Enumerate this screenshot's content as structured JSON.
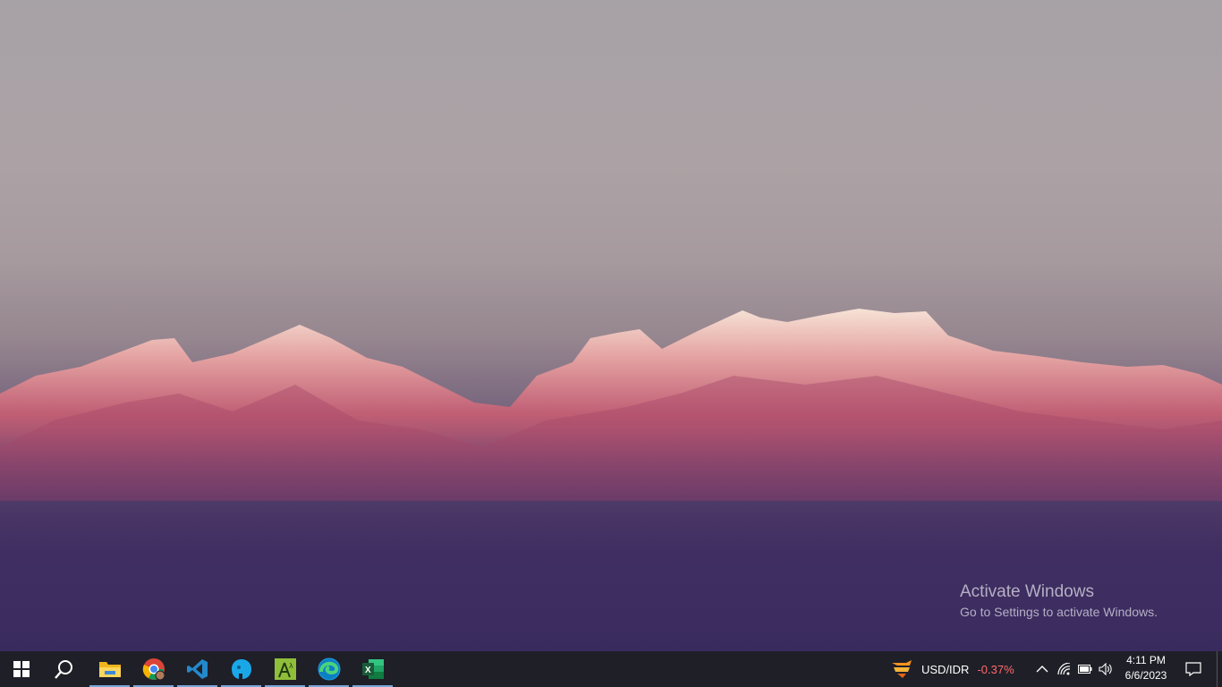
{
  "desktop": {
    "wallpaper": "mountain-range-sunset",
    "watermark": {
      "title": "Activate Windows",
      "subtitle": "Go to Settings to activate Windows."
    }
  },
  "taskbar": {
    "start_icon": "windows-start-icon",
    "search_icon": "search-icon",
    "pinned_apps": [
      {
        "name": "File Explorer",
        "icon": "file-explorer-icon",
        "active": true
      },
      {
        "name": "Google Chrome",
        "icon": "chrome-icon",
        "active": true
      },
      {
        "name": "Visual Studio Code",
        "icon": "vscode-icon",
        "active": true
      },
      {
        "name": "App",
        "icon": "blue-app-icon",
        "active": true
      },
      {
        "name": "App",
        "icon": "green-app-icon",
        "active": true
      },
      {
        "name": "Microsoft Edge",
        "icon": "edge-icon",
        "active": true
      },
      {
        "name": "Microsoft Excel",
        "icon": "excel-icon",
        "active": true
      }
    ],
    "widget": {
      "pair": "USD/IDR",
      "change": "-0.37%",
      "change_color": "#ff6b6b"
    },
    "tray": {
      "icons": [
        "chevron-up-icon",
        "wifi-icon",
        "battery-icon",
        "speaker-icon"
      ]
    },
    "clock": {
      "time": "4:11 PM",
      "date": "6/6/2023"
    },
    "notification_icon": "notification-icon"
  },
  "colors": {
    "taskbar_bg": "#1f1f28",
    "active_underline": "#7aa7d9"
  }
}
